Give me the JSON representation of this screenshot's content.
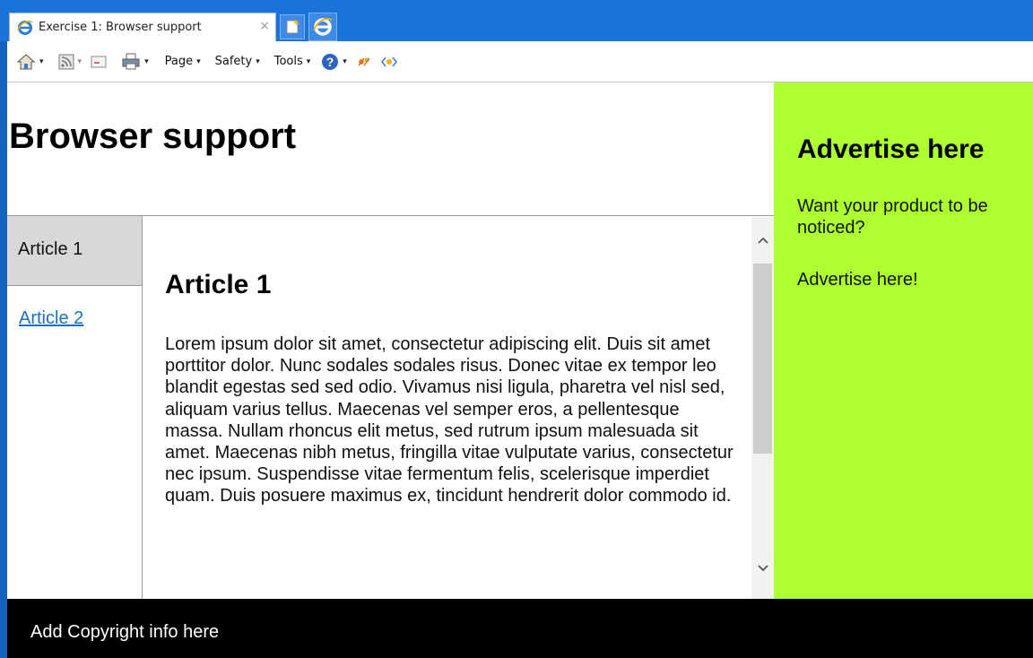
{
  "browser": {
    "tab_title": "Exercise 1: Browser support",
    "close_glyph": "×",
    "caret_glyph": "▾",
    "menus": {
      "page": "Page",
      "safety": "Safety",
      "tools": "Tools"
    },
    "icons": [
      "ie-logo-icon",
      "new-tab-icon",
      "home-icon",
      "feeds-icon",
      "read-mail-icon",
      "print-icon",
      "help-icon",
      "research-icon",
      "ie-dev-tools-icon"
    ]
  },
  "page": {
    "title": "Browser support",
    "nav": [
      {
        "label": "Article 1",
        "active": true
      },
      {
        "label": "Article 2",
        "active": false
      }
    ],
    "article": {
      "title": "Article 1",
      "body": "Lorem ipsum dolor sit amet, consectetur adipiscing elit. Duis sit amet porttitor dolor. Nunc sodales sodales risus. Donec vitae ex tempor leo blandit egestas sed sed odio. Vivamus nisi ligula, pharetra vel nisl sed, aliquam varius tellus. Maecenas vel semper eros, a pellentesque massa. Nullam rhoncus elit metus, sed rutrum ipsum malesuada sit amet. Maecenas nibh metus, fringilla vitae vulputate varius, consectetur nec ipsum. Suspendisse vitae fermentum felis, scelerisque imperdiet quam. Duis posuere maximus ex, tincidunt hendrerit dolor commodo id."
    },
    "ad": {
      "title": "Advertise here",
      "text": "Want your product to be noticed?",
      "link": "Advertise here!",
      "color": "#adff2f"
    },
    "footer": "Add Copyright info here"
  }
}
